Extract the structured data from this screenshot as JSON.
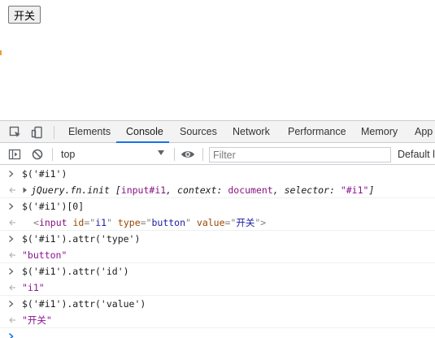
{
  "page": {
    "button_value": "开关"
  },
  "devtools": {
    "tabs": [
      "Elements",
      "Console",
      "Sources",
      "Network",
      "Performance",
      "Memory",
      "App"
    ],
    "active_tab": "Console",
    "toolbar": {
      "context": "top",
      "filter_placeholder": "Filter",
      "levels": "Default l"
    },
    "accent_color": "#1a73e8"
  },
  "console": {
    "entries": [
      {
        "type": "input",
        "parts": [
          {
            "t": "$('#i1')",
            "c": "js"
          }
        ]
      },
      {
        "type": "output",
        "parts": [
          {
            "t": "jQuery.fn.init [",
            "c": "obj"
          },
          {
            "t": "input#i1",
            "c": "tag"
          },
          {
            "t": ", context: ",
            "c": "obj"
          },
          {
            "t": "document",
            "c": "tag"
          },
          {
            "t": ", selector: ",
            "c": "obj"
          },
          {
            "t": "\"#i1\"",
            "c": "str"
          },
          {
            "t": "]",
            "c": "obj"
          }
        ]
      },
      {
        "type": "input",
        "parts": [
          {
            "t": "$('#i1')[0]",
            "c": "js"
          }
        ]
      },
      {
        "type": "output",
        "parts": [
          {
            "t": "<",
            "c": "gray"
          },
          {
            "t": "input",
            "c": "tag"
          },
          {
            "t": " id",
            "c": "attr-n"
          },
          {
            "t": "=\"",
            "c": "gray"
          },
          {
            "t": "i1",
            "c": "attr-v"
          },
          {
            "t": "\"",
            "c": "gray"
          },
          {
            "t": " type",
            "c": "attr-n"
          },
          {
            "t": "=\"",
            "c": "gray"
          },
          {
            "t": "button",
            "c": "attr-v"
          },
          {
            "t": "\"",
            "c": "gray"
          },
          {
            "t": " value",
            "c": "attr-n"
          },
          {
            "t": "=\"",
            "c": "gray"
          },
          {
            "t": "开关",
            "c": "attr-v"
          },
          {
            "t": "\">",
            "c": "gray"
          }
        ]
      },
      {
        "type": "input",
        "parts": [
          {
            "t": "$('#i1').attr('type')",
            "c": "js"
          }
        ]
      },
      {
        "type": "output",
        "parts": [
          {
            "t": "\"button\"",
            "c": "str"
          }
        ]
      },
      {
        "type": "input",
        "parts": [
          {
            "t": "$('#i1').attr('id')",
            "c": "js"
          }
        ]
      },
      {
        "type": "output",
        "parts": [
          {
            "t": "\"i1\"",
            "c": "str"
          }
        ]
      },
      {
        "type": "input",
        "parts": [
          {
            "t": "$('#i1').attr('value')",
            "c": "js"
          }
        ]
      },
      {
        "type": "output",
        "parts": [
          {
            "t": "\"开关\"",
            "c": "str"
          }
        ]
      }
    ]
  }
}
